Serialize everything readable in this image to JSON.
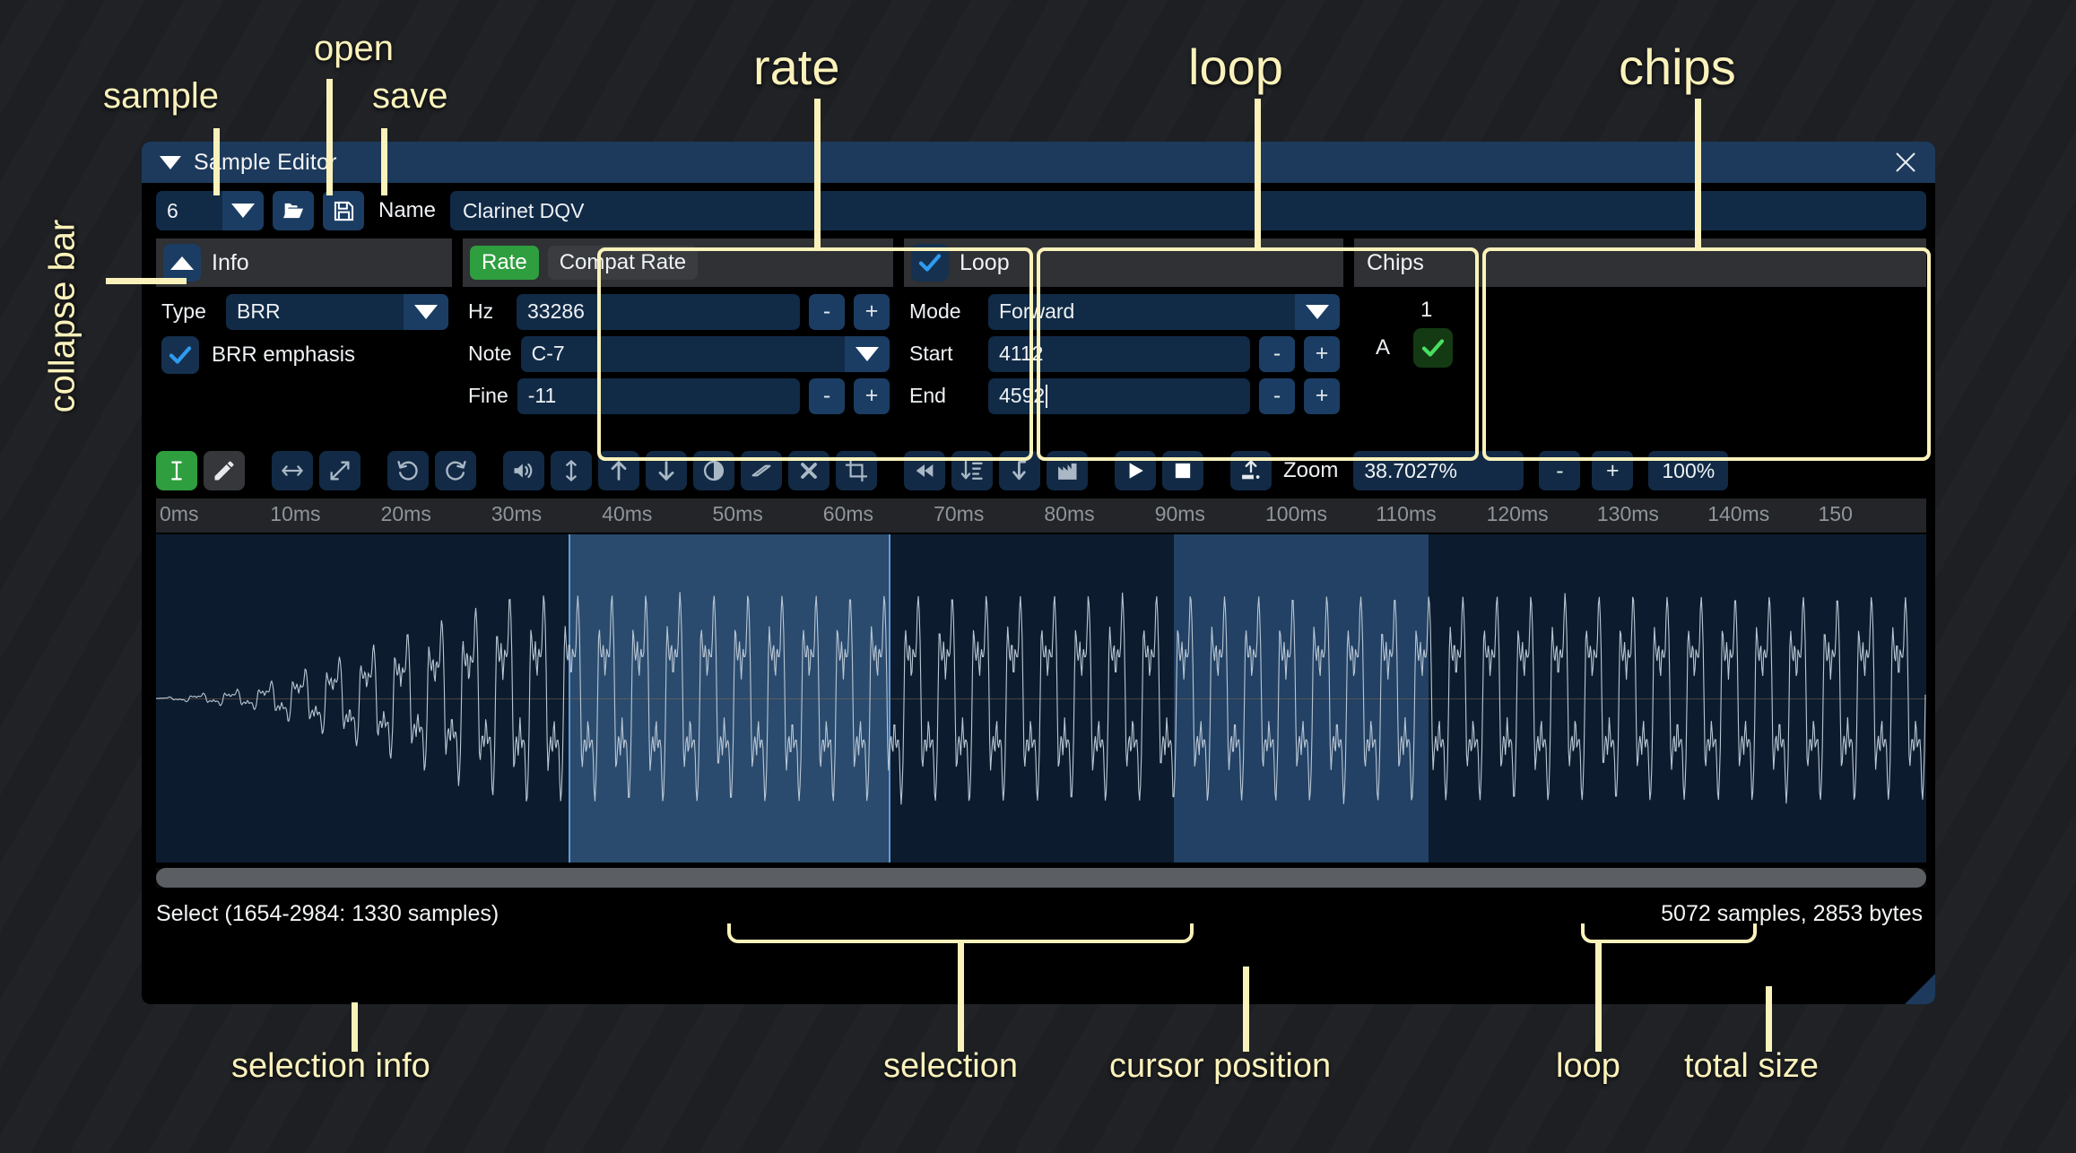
{
  "window": {
    "title": "Sample Editor",
    "collapse_icon": "triangle-down-icon",
    "close_icon": "close-icon"
  },
  "toprow": {
    "sample_index": "6",
    "open_label": "open-folder-icon",
    "save_label": "save-disk-icon",
    "name_label": "Name",
    "name_value": "Clarinet DQV"
  },
  "info_panel": {
    "title": "Info",
    "collapse_icon": "chevron-up-icon",
    "type_label": "Type",
    "type_value": "BRR",
    "emphasis_label": "BRR emphasis",
    "emphasis_checked": true
  },
  "rate_panel": {
    "badge": "Rate",
    "compat_badge": "Compat Rate",
    "hz_label": "Hz",
    "hz_value": "33286",
    "note_label": "Note",
    "note_value": "C-7",
    "fine_label": "Fine",
    "fine_value": "-11",
    "minus": "-",
    "plus": "+"
  },
  "loop_panel": {
    "title": "Loop",
    "enabled": true,
    "mode_label": "Mode",
    "mode_value": "Forward",
    "start_label": "Start",
    "start_value": "4112",
    "end_label": "End",
    "end_value": "4592",
    "minus": "-",
    "plus": "+"
  },
  "chips_panel": {
    "title": "Chips",
    "column_header": "1",
    "row_label": "A",
    "checked": true
  },
  "toolbar": {
    "tools": [
      {
        "name": "select-tool",
        "state": "active"
      },
      {
        "name": "pencil-tool",
        "state": "idle"
      },
      {
        "name": "resize-horizontal-icon",
        "state": "idle"
      },
      {
        "name": "resize-diagonal-icon",
        "state": "idle"
      },
      {
        "name": "undo-icon",
        "state": "idle"
      },
      {
        "name": "redo-icon",
        "state": "idle"
      },
      {
        "name": "volume-icon",
        "state": "idle"
      },
      {
        "name": "arrows-vertical-icon",
        "state": "idle"
      },
      {
        "name": "arrow-up-icon",
        "state": "idle"
      },
      {
        "name": "arrow-down-icon",
        "state": "idle"
      },
      {
        "name": "contrast-icon",
        "state": "idle"
      },
      {
        "name": "eraser-icon",
        "state": "idle"
      },
      {
        "name": "delete-x-icon",
        "state": "idle"
      },
      {
        "name": "crop-icon",
        "state": "idle"
      },
      {
        "name": "rewind-icon",
        "state": "idle"
      },
      {
        "name": "sort-descending-icon",
        "state": "idle"
      },
      {
        "name": "arrow-turn-down-icon",
        "state": "idle"
      },
      {
        "name": "waveform-chart-icon",
        "state": "idle"
      },
      {
        "name": "play-icon",
        "state": "idle"
      },
      {
        "name": "stop-icon",
        "state": "idle"
      },
      {
        "name": "export-upload-icon",
        "state": "idle"
      }
    ],
    "zoom_label": "Zoom",
    "zoom_value": "38.7027%",
    "zoom_minus": "-",
    "zoom_plus": "+",
    "zoom_reset": "100%"
  },
  "ruler": {
    "ticks": [
      "0ms",
      "10ms",
      "20ms",
      "30ms",
      "40ms",
      "50ms",
      "60ms",
      "70ms",
      "80ms",
      "90ms",
      "100ms",
      "110ms",
      "120ms",
      "130ms",
      "140ms",
      "150"
    ]
  },
  "status": {
    "left": "Select (1654-2984: 1330 samples)",
    "right": "5072 samples, 2853 bytes"
  },
  "annotations": [
    {
      "id": "sample",
      "text": "sample"
    },
    {
      "id": "open",
      "text": "open"
    },
    {
      "id": "save",
      "text": "save"
    },
    {
      "id": "rate",
      "text": "rate"
    },
    {
      "id": "loop",
      "text": "loop"
    },
    {
      "id": "chips",
      "text": "chips"
    },
    {
      "id": "collapse_bar",
      "text": "collapse bar"
    },
    {
      "id": "selection_info",
      "text": "selection info"
    },
    {
      "id": "selection",
      "text": "selection"
    },
    {
      "id": "cursor_position",
      "text": "cursor position"
    },
    {
      "id": "loop_bottom",
      "text": "loop"
    },
    {
      "id": "total_size",
      "text": "total size"
    }
  ],
  "colors": {
    "accent_blue": "#1d3a5c",
    "field_blue": "#112a46",
    "green": "#2f9e3f",
    "annotation_yellow": "#fbf2bb",
    "selection": "#4a84c4"
  }
}
